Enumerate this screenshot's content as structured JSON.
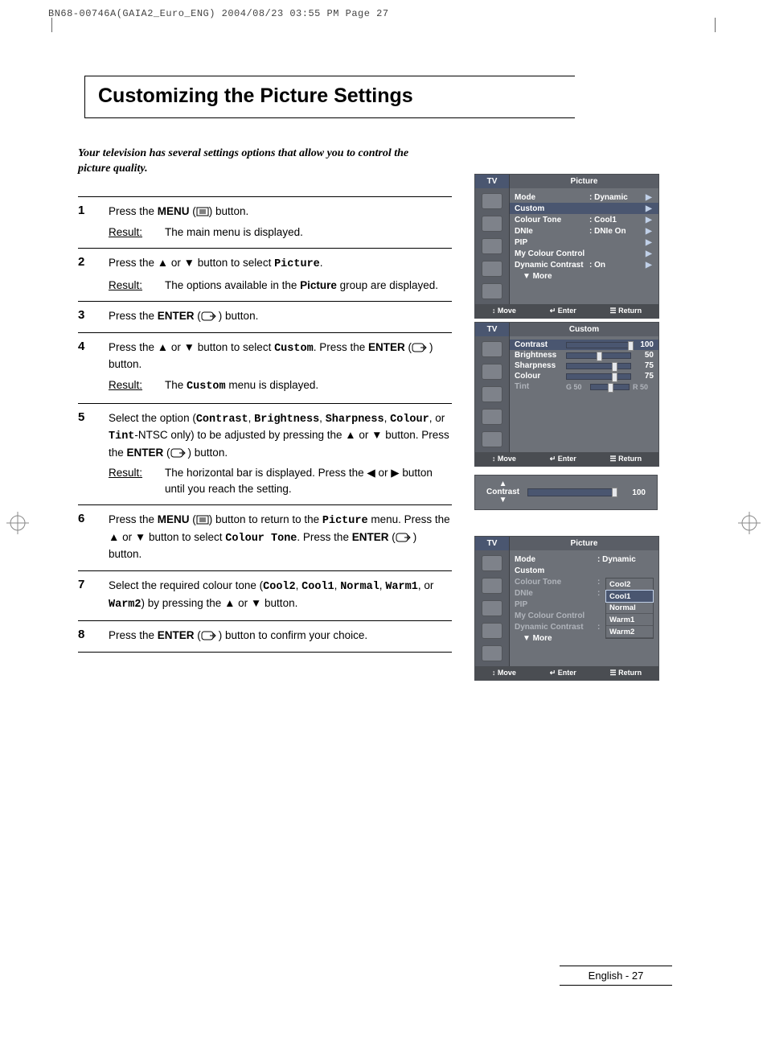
{
  "header_line": "BN68-00746A(GAIA2_Euro_ENG)  2004/08/23  03:55 PM  Page 27",
  "title": "Customizing the Picture Settings",
  "intro": "Your television has several settings options that allow you to control the picture quality.",
  "steps": [
    {
      "num": "1",
      "pre": "Press the ",
      "bold1": "MENU",
      "mid": " (",
      "icon": "menu",
      "post": ") button.",
      "result": "The main menu is displayed."
    },
    {
      "num": "2",
      "text_html": "Press the ▲ or ▼ button to select <span class='monob'>Picture</span>.",
      "result": "The options available in the <span class='b'>Picture</span> group are displayed."
    },
    {
      "num": "3",
      "text_html": "Press the <span class='b'>ENTER</span> (<svg class='ico' width='22' height='12'><rect x='1' y='1' width='14' height='10' rx='3' fill='none' stroke='#000'/><path d='M11 6 h6 M15 3 l3 3 l-3 3' fill='none' stroke='#000'/></svg>) button."
    },
    {
      "num": "4",
      "text_html": "Press the ▲ or ▼ button to select <span class='monob'>Custom</span>. Press the <span class='b'>ENTER</span> (<svg class='ico' width='22' height='12'><rect x='1' y='1' width='14' height='10' rx='3' fill='none' stroke='#000'/><path d='M11 6 h6 M15 3 l3 3 l-3 3' fill='none' stroke='#000'/></svg>) button.",
      "result": "The <span class='monob'>Custom</span> menu is displayed."
    },
    {
      "num": "5",
      "text_html": "Select the option (<span class='monob'>Contrast</span>, <span class='monob'>Brightness</span>, <span class='monob'>Sharpness</span>, <span class='monob'>Colour</span>, or <span class='monob'>Tint</span>-NTSC only) to be adjusted by pressing the ▲ or ▼ button. Press the <span class='b'>ENTER</span> (<svg class='ico' width='22' height='12'><rect x='1' y='1' width='14' height='10' rx='3' fill='none' stroke='#000'/><path d='M11 6 h6 M15 3 l3 3 l-3 3' fill='none' stroke='#000'/></svg>) button.",
      "result": "The horizontal bar is displayed. Press the ◀ or ▶ button until you reach the setting."
    },
    {
      "num": "6",
      "text_html": "Press the <span class='b'>MENU</span> (<svg class='ico' width='16' height='12'><rect x='1' y='1' width='14' height='10' fill='none' stroke='#000'/><line x1='4' y1='4' x2='12' y2='4' stroke='#000'/><line x1='4' y1='6' x2='12' y2='6' stroke='#000'/><line x1='4' y1='8' x2='12' y2='8' stroke='#000'/></svg>) button to return to the <span class='monob'>Picture</span> menu. Press the ▲ or ▼ button to select <span class='monob'>Colour Tone</span>. Press the <span class='b'>ENTER</span> (<svg class='ico' width='22' height='12'><rect x='1' y='1' width='14' height='10' rx='3' fill='none' stroke='#000'/><path d='M11 6 h6 M15 3 l3 3 l-3 3' fill='none' stroke='#000'/></svg>) button."
    },
    {
      "num": "7",
      "text_html": "Select the required colour tone (<span class='monob'>Cool2</span>, <span class='monob'>Cool1</span>, <span class='monob'>Normal</span>, <span class='monob'>Warm1</span>, or <span class='monob'>Warm2</span>) by pressing the ▲ or ▼ button."
    },
    {
      "num": "8",
      "text_html": "Press the <span class='b'>ENTER</span> (<svg class='ico' width='22' height='12'><rect x='1' y='1' width='14' height='10' rx='3' fill='none' stroke='#000'/><path d='M11 6 h6 M15 3 l3 3 l-3 3' fill='none' stroke='#000'/></svg>) button to confirm your choice."
    }
  ],
  "osd1": {
    "tv": "TV",
    "title": "Picture",
    "rows": [
      {
        "label": "Mode",
        "val": ": Dynamic",
        "arrow": "▶"
      },
      {
        "label": "Custom",
        "val": "",
        "arrow": "▶",
        "hl": true
      },
      {
        "label": "Colour Tone",
        "val": ": Cool1",
        "arrow": "▶"
      },
      {
        "label": "DNIe",
        "val": ": DNIe On",
        "arrow": "▶"
      },
      {
        "label": "PIP",
        "val": "",
        "arrow": "▶"
      },
      {
        "label": "My Colour Control",
        "val": "",
        "arrow": "▶"
      },
      {
        "label": "Dynamic Contrast",
        "val": ": On",
        "arrow": "▶"
      }
    ],
    "more": "▼ More",
    "footer": [
      "Move",
      "Enter",
      "Return"
    ],
    "footer_icons": [
      "↕",
      "↵",
      "☰"
    ]
  },
  "osd2": {
    "tv": "TV",
    "title": "Custom",
    "sliders": [
      {
        "label": "Contrast",
        "val": "100",
        "pos": 100,
        "hl": true
      },
      {
        "label": "Brightness",
        "val": "50",
        "pos": 50
      },
      {
        "label": "Sharpness",
        "val": "75",
        "pos": 75
      },
      {
        "label": "Colour",
        "val": "75",
        "pos": 75
      }
    ],
    "tint": {
      "label": "Tint",
      "l": "G 50",
      "r": "R 50",
      "pos": 50
    },
    "footer": [
      "Move",
      "Enter",
      "Return"
    ],
    "footer_icons": [
      "↕",
      "↵",
      "☰"
    ]
  },
  "contrast_bar": {
    "label": "Contrast",
    "val": "100",
    "pos": 100
  },
  "osd3": {
    "tv": "TV",
    "title": "Picture",
    "rows": [
      {
        "label": "Mode",
        "val": ": Dynamic"
      },
      {
        "label": "Custom",
        "val": ""
      },
      {
        "label": "Colour Tone",
        "val": ":",
        "dim": true
      },
      {
        "label": "DNIe",
        "val": ":",
        "dim": true
      },
      {
        "label": "PIP",
        "val": "",
        "dim": true
      },
      {
        "label": "My Colour Control",
        "val": "",
        "dim": true
      },
      {
        "label": "Dynamic Contrast",
        "val": ":",
        "dim": true
      }
    ],
    "more": "▼ More",
    "submenu": [
      "Cool2",
      "Cool1",
      "Normal",
      "Warm1",
      "Warm2"
    ],
    "submenu_sel": 1,
    "footer": [
      "Move",
      "Enter",
      "Return"
    ],
    "footer_icons": [
      "↕",
      "↵",
      "☰"
    ]
  },
  "result_label": "Result:",
  "page_foot": "English - 27"
}
